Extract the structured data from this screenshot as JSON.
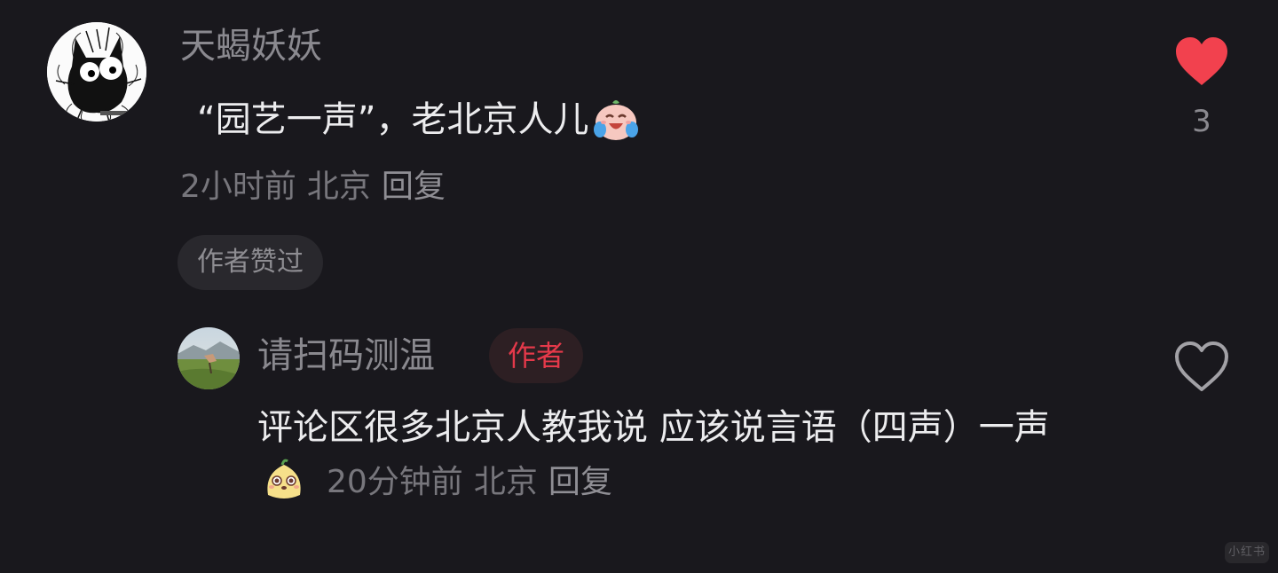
{
  "main_comment": {
    "username": "天蝎妖妖",
    "text": "“园艺一声”，老北京人儿",
    "emoji": "laughing-crying-sticker",
    "time": "2小时前",
    "location": "北京",
    "reply_label": "回复",
    "liked_badge": "作者赞过",
    "like_count": "3",
    "liked": true,
    "avatar_icon": "black-cat-icon"
  },
  "reply_comment": {
    "username": "请扫码测温",
    "author_tag": "作者",
    "text": "评论区很多北京人教我说 应该说言语（四声）一声",
    "emoji": "puppy-face-sticker",
    "time": "20分钟前",
    "location": "北京",
    "reply_label": "回复",
    "liked": false,
    "avatar_icon": "landscape-photo"
  },
  "watermark": "小红书",
  "colors": {
    "background": "#19181d",
    "like_active": "#f2414e",
    "author_tag_text": "#e5394a",
    "muted_text": "#8a898f"
  }
}
